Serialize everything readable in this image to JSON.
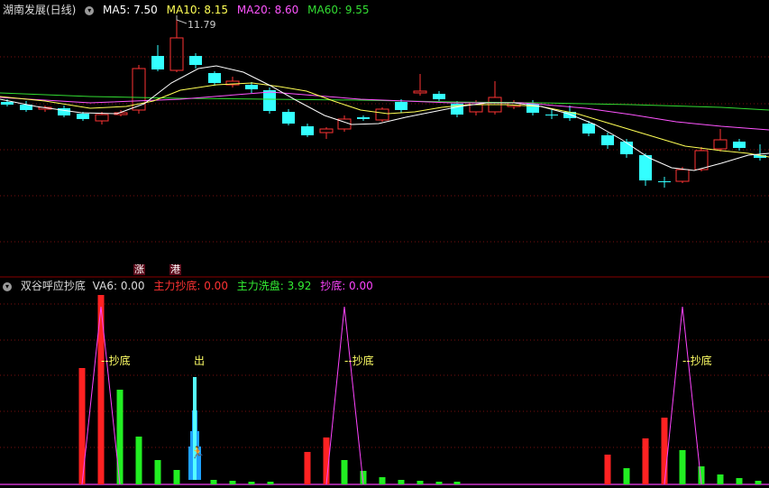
{
  "main_header": {
    "stock_name": "湖南发展(日线)",
    "ma_items": [
      {
        "label": "MA5: 7.50",
        "color": "#ffffff"
      },
      {
        "label": "MA10: 8.15",
        "color": "#ffff55"
      },
      {
        "label": "MA20: 8.60",
        "color": "#ff55ff"
      },
      {
        "label": "MA60: 9.55",
        "color": "#33dd33"
      }
    ]
  },
  "peak_label": "11.79",
  "flags": {
    "zhang": "涨",
    "gang": "港"
  },
  "indicator_header": {
    "name": "双谷呼应抄底",
    "items": [
      {
        "label": "VA6: 0.00",
        "color": "#dddddd"
      },
      {
        "label": "主力抄底: 0.00",
        "color": "#ff3333"
      },
      {
        "label": "主力洗盘: 3.92",
        "color": "#33ee33"
      },
      {
        "label": "抄底: 0.00",
        "color": "#ff44ff"
      }
    ]
  },
  "signals": [
    {
      "text": "--抄底",
      "color": "#ffff66"
    },
    {
      "text": "出",
      "color": "#ffff66"
    },
    {
      "text": "--抄底",
      "color": "#ffff66"
    },
    {
      "text": "--抄底",
      "color": "#ffff66"
    }
  ],
  "colors": {
    "up": "#ff3333",
    "down": "#33ffff",
    "divider": "#880000",
    "grid": "#7a1010"
  }
}
